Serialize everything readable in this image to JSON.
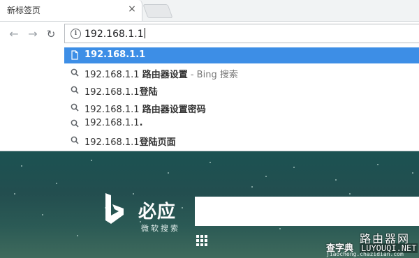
{
  "tab": {
    "title": "新标签页",
    "close": "×"
  },
  "toolbar": {
    "back": "←",
    "forward": "→",
    "reload": "↻",
    "omnibox_value": "192.168.1.1",
    "info": "i"
  },
  "suggestions": [
    {
      "type": "page",
      "icon": "page-icon",
      "parts": [
        {
          "text": "192.168.1.1",
          "style": "bold"
        }
      ]
    },
    {
      "type": "search",
      "icon": "search-icon",
      "parts": [
        {
          "text": "192.168.1.1 ",
          "style": "normal"
        },
        {
          "text": "路由器设置",
          "style": "bold"
        },
        {
          "text": " - Bing 搜索",
          "style": "muted"
        }
      ]
    },
    {
      "type": "search",
      "icon": "search-icon",
      "parts": [
        {
          "text": "192.168.1.1",
          "style": "normal"
        },
        {
          "text": "登陆",
          "style": "bold"
        }
      ]
    },
    {
      "type": "search",
      "icon": "search-icon",
      "parts": [
        {
          "text": "192.168.1.1 ",
          "style": "normal"
        },
        {
          "text": "路由器设置密码",
          "style": "bold"
        }
      ]
    },
    {
      "type": "search",
      "icon": "search-icon",
      "parts": [
        {
          "text": "192.168.1.1",
          "style": "normal"
        },
        {
          "text": ".",
          "style": "bold"
        }
      ]
    },
    {
      "type": "search",
      "icon": "search-icon",
      "parts": [
        {
          "text": "192.168.1.1",
          "style": "normal"
        },
        {
          "text": "登陆页面",
          "style": "bold"
        }
      ]
    }
  ],
  "bing": {
    "name": "必应",
    "subtitle": "微软搜索"
  },
  "watermark": {
    "line1": "路由器网",
    "line2": "查字典",
    "line3": "LUYOUQI.NET",
    "line4": "jiaocheng.chazidian.com"
  },
  "colors": {
    "selected": "#3d8ee6",
    "bing_bg": "#234e4f"
  }
}
